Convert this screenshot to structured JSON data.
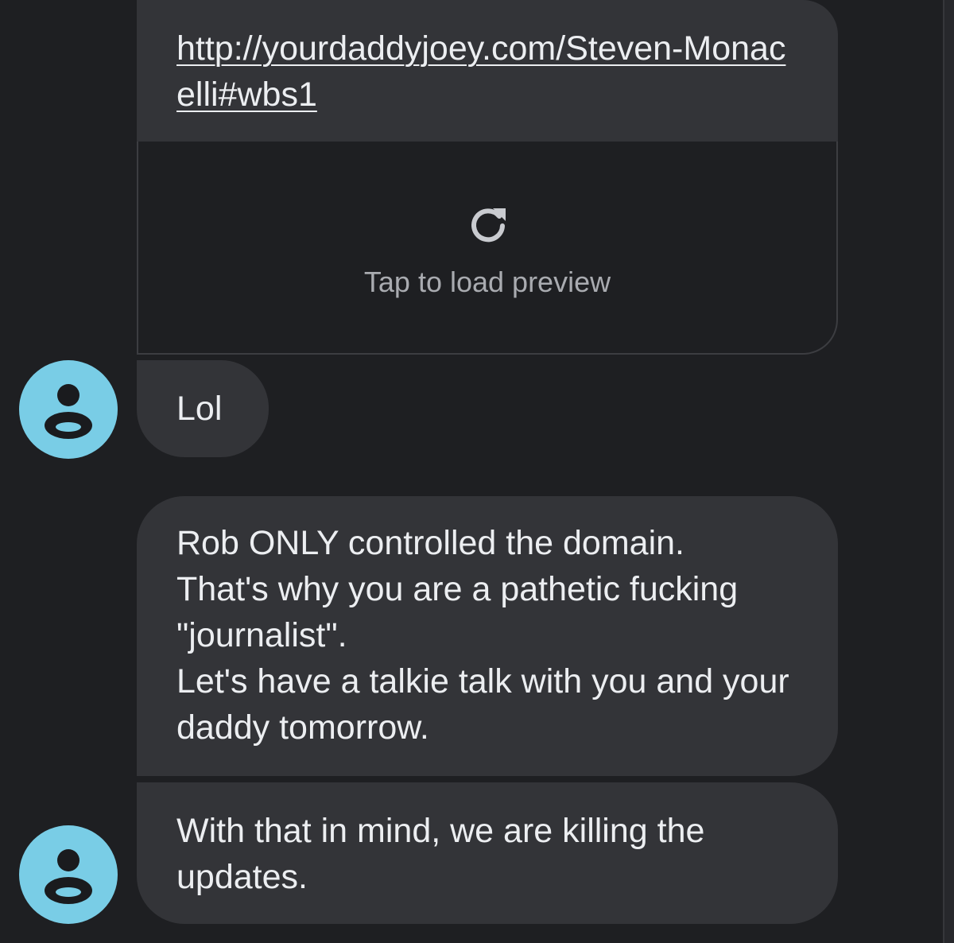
{
  "conversation": {
    "link_message": {
      "url_text": "http://yourdaddyjoey.com/Steven-Monacelli#wbs1",
      "preview_label": "Tap to load preview",
      "preview_icon": "reload-icon"
    },
    "messages": [
      {
        "text": "Lol",
        "avatar_icon": "person-icon"
      },
      {
        "text": "Rob ONLY controlled the domain.\nThat's why you are a pathetic fucking \"journalist\".\nLet's have a talkie talk with you and your daddy tomorrow."
      },
      {
        "text": "With that in mind, we are killing the updates.",
        "avatar_icon": "person-icon"
      }
    ]
  },
  "colors": {
    "background": "#1e1f22",
    "bubble": "#333438",
    "avatar": "#79cde6",
    "text": "#eceef1",
    "muted_text": "#a9abb0"
  }
}
